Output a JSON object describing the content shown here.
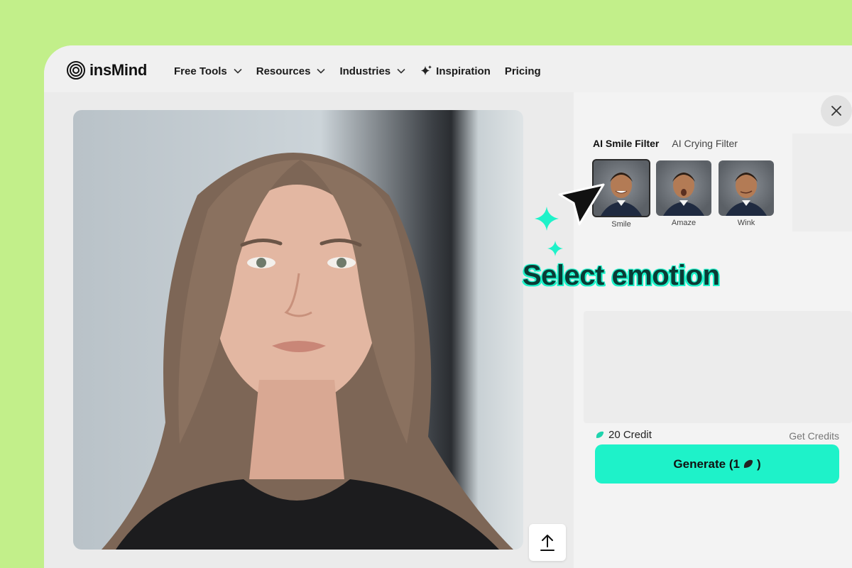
{
  "header": {
    "logo_text": "insMind",
    "nav": [
      {
        "label": "Free Tools",
        "icon": "chevron-down-icon"
      },
      {
        "label": "Resources",
        "icon": "chevron-down-icon"
      },
      {
        "label": "Industries",
        "icon": "chevron-down-icon"
      },
      {
        "label": "Inspiration",
        "icon": "sparkle-icon"
      },
      {
        "label": "Pricing"
      }
    ]
  },
  "panel": {
    "tabs": [
      {
        "label": "AI Smile Filter",
        "active": true
      },
      {
        "label": "AI Crying Filter",
        "active": false
      }
    ],
    "thumbnails": [
      {
        "label": "Smile",
        "selected": true
      },
      {
        "label": "Amaze",
        "selected": false
      },
      {
        "label": "Wink",
        "selected": false
      }
    ],
    "credit": "20 Credit",
    "get_credits": "Get Credits",
    "generate_label": "Generate (1",
    "generate_suffix": ")"
  },
  "overlay": {
    "caption": "Select emotion"
  },
  "colors": {
    "background": "#c2ef8a",
    "accent": "#1ef2c9",
    "caption_text": "#0b3a35"
  }
}
